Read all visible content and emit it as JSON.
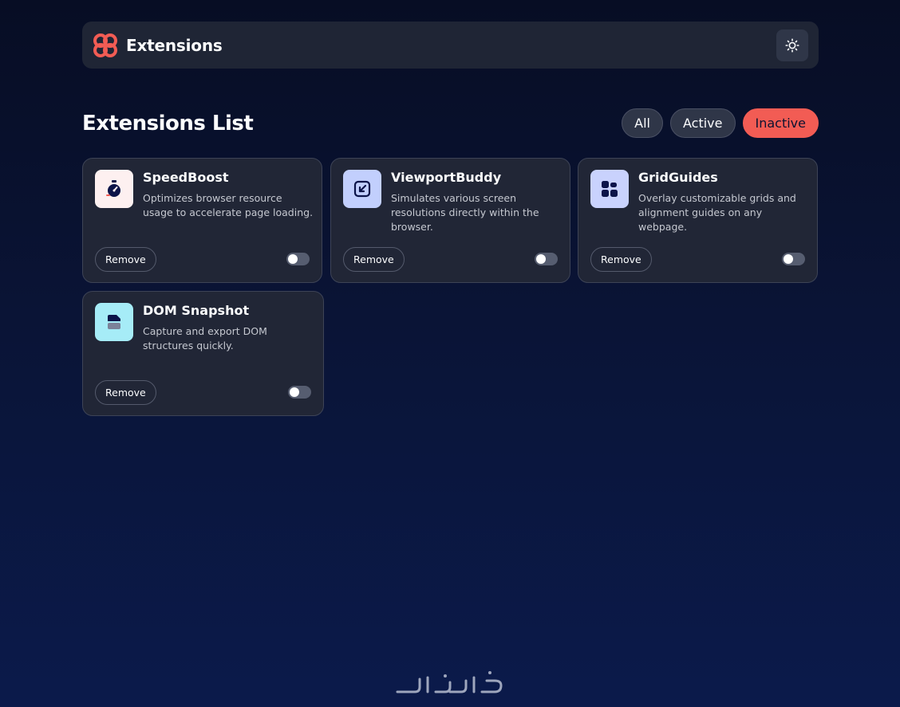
{
  "header": {
    "brand_name": "Extensions",
    "theme_toggle_icon": "sun-icon",
    "logo_color": "#f25c54"
  },
  "list": {
    "title": "Extensions List",
    "filters": [
      {
        "label": "All",
        "active": false
      },
      {
        "label": "Active",
        "active": false
      },
      {
        "label": "Inactive",
        "active": true
      }
    ]
  },
  "extensions": [
    {
      "name": "SpeedBoost",
      "description": "Optimizes browser resource usage to accelerate page loading.",
      "icon": "stopwatch-icon",
      "icon_bg": "#fdf0f0",
      "remove_label": "Remove",
      "enabled": false
    },
    {
      "name": "ViewportBuddy",
      "description": "Simulates various screen resolutions directly within the browser.",
      "icon": "external-link-icon",
      "icon_bg": "#c2cffd",
      "remove_label": "Remove",
      "enabled": false
    },
    {
      "name": "GridGuides",
      "description": "Overlay customizable grids and alignment guides on any webpage.",
      "icon": "grid-icon",
      "icon_bg": "#c9d2fd",
      "remove_label": "Remove",
      "enabled": false
    },
    {
      "name": "DOM Snapshot",
      "description": "Capture and export DOM structures quickly.",
      "icon": "document-icon",
      "icon_bg": "#a6ecf7",
      "remove_label": "Remove",
      "enabled": false
    }
  ],
  "colors": {
    "accent": "#f25c54",
    "card_bg": "#212636",
    "icon_dark": "#0c1449"
  }
}
